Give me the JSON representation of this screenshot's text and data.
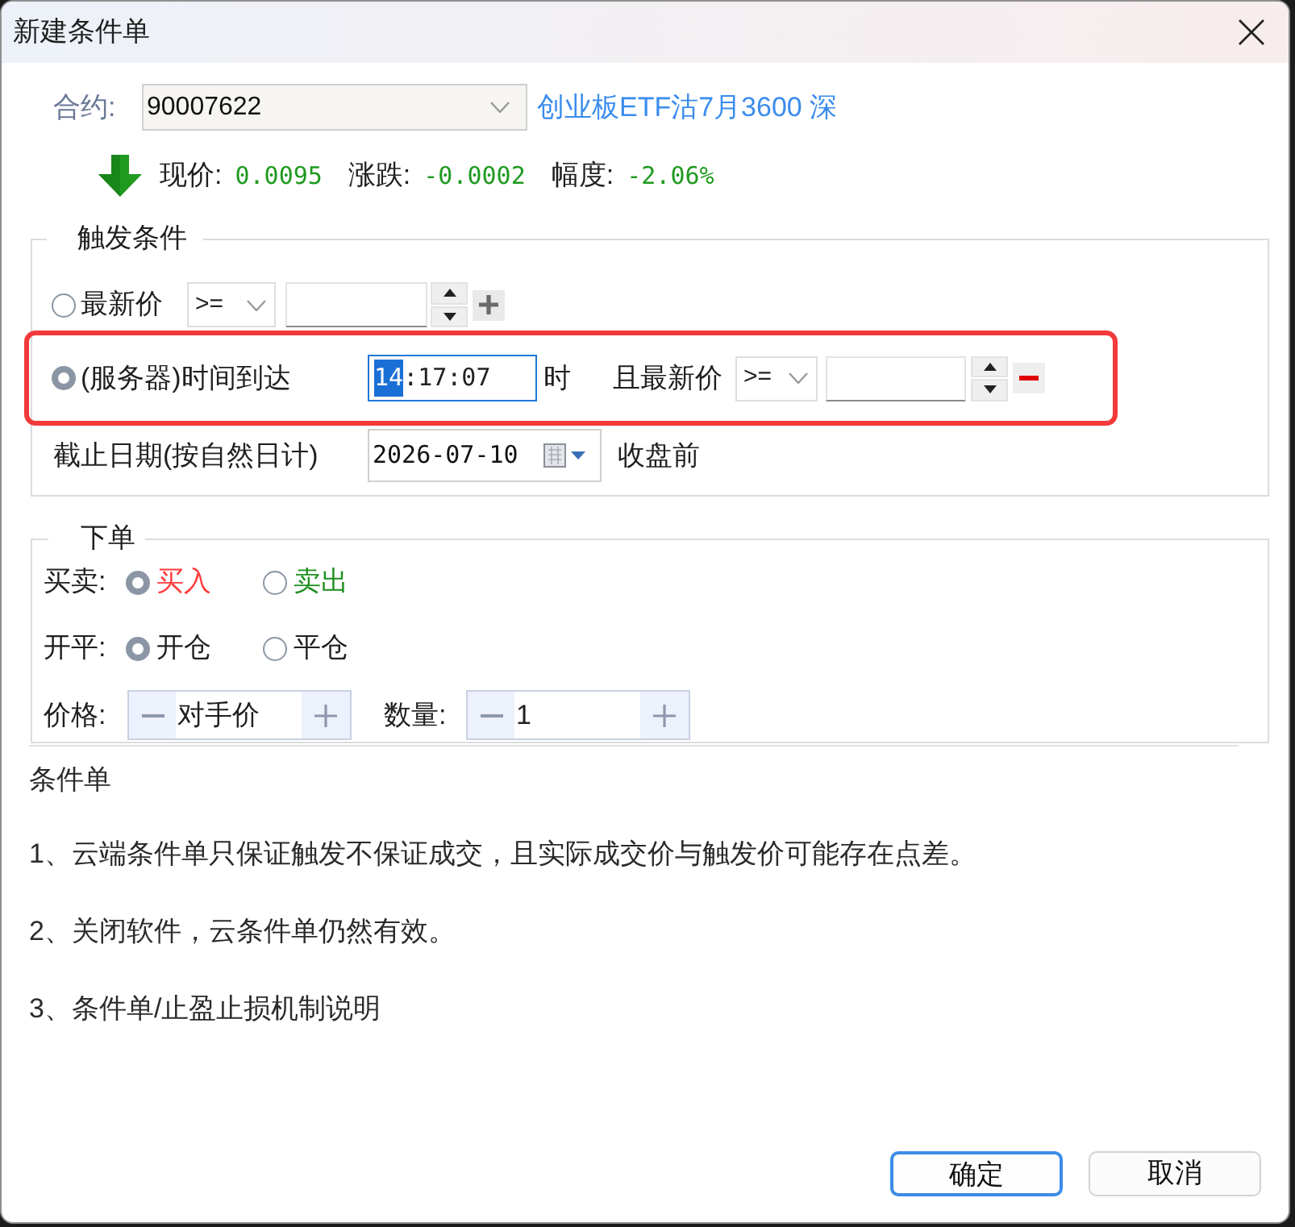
{
  "window": {
    "title": "新建条件单"
  },
  "contract": {
    "label": "合约:",
    "code": "90007622",
    "name": "创业板ETF沽7月3600 深"
  },
  "quote": {
    "falling": true,
    "items": [
      {
        "label": "现价:",
        "value": "0.0095"
      },
      {
        "label": "涨跌:",
        "value": "-0.0002"
      },
      {
        "label": "幅度:",
        "value": "-2.06%"
      }
    ]
  },
  "trigger": {
    "legend": "触发条件",
    "conditions": [
      {
        "kind": "price",
        "selected": false,
        "highlighted": false,
        "label": "最新价",
        "operator": ">=",
        "removable": false
      },
      {
        "kind": "time",
        "selected": true,
        "highlighted": true,
        "label": "(服务器)时间到达",
        "time_selected": "14",
        "time_rest": ":17:07",
        "unit": "时",
        "price_label": "且最新价",
        "operator": ">=",
        "removable": true
      }
    ],
    "expiry": {
      "label": "截止日期(按自然日计)",
      "date": "2026-07-10",
      "suffix": "收盘前"
    }
  },
  "order": {
    "legend": "下单",
    "rows": [
      {
        "kind": "radio",
        "label": "买卖:",
        "options": [
          {
            "text": "买入",
            "selected": true,
            "color": "#ff3b3b"
          },
          {
            "text": "卖出",
            "selected": false,
            "color": "#1f8f1f"
          }
        ]
      },
      {
        "kind": "radio",
        "label": "开平:",
        "options": [
          {
            "text": "开仓",
            "selected": true
          },
          {
            "text": "平仓",
            "selected": false
          }
        ]
      },
      {
        "kind": "steppers",
        "fields": [
          {
            "label": "价格:",
            "value": "对手价"
          },
          {
            "label": "数量:",
            "value": "1"
          }
        ]
      }
    ]
  },
  "notes": {
    "title": "条件单",
    "items": [
      "1、云端条件单只保证触发不保证成交，且实际成交价与触发价可能存在点差。",
      "2、关闭软件，云条件单仍然有效。",
      "3、条件单/止盈止损机制说明"
    ]
  },
  "buttons": [
    {
      "label": "确定",
      "default": true
    },
    {
      "label": "取消",
      "default": false
    }
  ]
}
